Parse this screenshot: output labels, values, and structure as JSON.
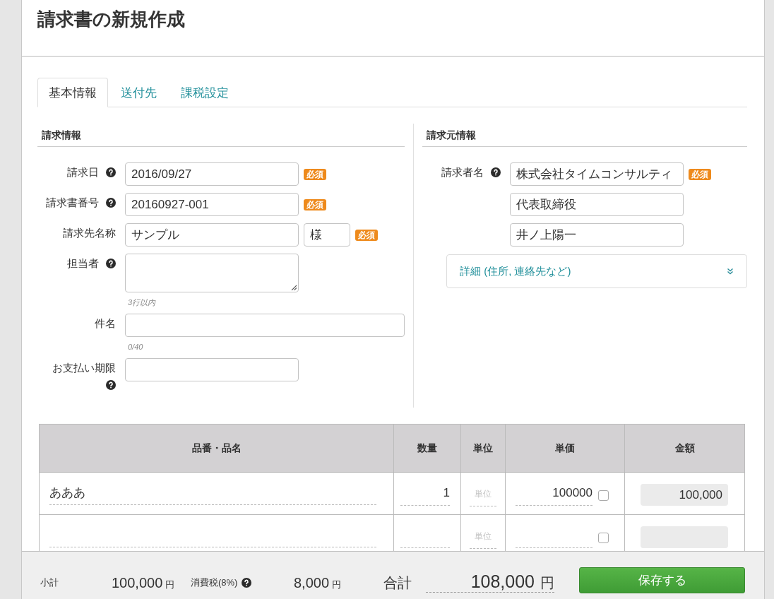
{
  "page": {
    "title": "請求書の新規作成"
  },
  "tabs": [
    {
      "label": "基本情報",
      "selected": true
    },
    {
      "label": "送付先",
      "selected": false
    },
    {
      "label": "課税設定",
      "selected": false
    }
  ],
  "invoice_info": {
    "heading": "請求情報",
    "fields": [
      {
        "kind": "text",
        "label": "請求日",
        "help": true,
        "value": "2016/09/27",
        "badge": "必須"
      },
      {
        "kind": "text",
        "label": "請求書番号",
        "help": true,
        "value": "20160927-001",
        "badge": "必須"
      },
      {
        "kind": "text_with_suffix",
        "label": "請求先名称",
        "help": false,
        "value": "サンプル",
        "suffix": "様",
        "badge": "必須"
      },
      {
        "kind": "textarea",
        "label": "担当者",
        "help": true,
        "hint": "3行以内"
      },
      {
        "kind": "wide_text",
        "label": "件名",
        "help": false,
        "hint": "0/40"
      },
      {
        "kind": "text",
        "label": "お支払い期限",
        "help": true
      }
    ]
  },
  "issuer_info": {
    "heading": "請求元情報",
    "label": "請求者名",
    "help": true,
    "fields": [
      {
        "value": "株式会社タイムコンサルティ",
        "badge": "必須"
      },
      {
        "value": "代表取締役"
      },
      {
        "value": "井ノ上陽一"
      }
    ],
    "details": {
      "label": "詳細 (住所, 連絡先など)",
      "expanded": false
    }
  },
  "items_table": {
    "columns": [
      "品番・品名",
      "数量",
      "単位",
      "単価",
      "金額"
    ],
    "rows": [
      {
        "name": "あああ",
        "quantity": "1",
        "unit_placeholder": "単位",
        "unit_price": "100000",
        "checked": false,
        "amount": "100,000"
      },
      {
        "unit_placeholder": "単位",
        "checked": false
      }
    ]
  },
  "footer": {
    "subtotal_label": "小計",
    "subtotal": "100,000",
    "subtotal_unit": "円",
    "tax_label": "消費税(8%)",
    "tax_help": true,
    "tax": "8,000",
    "tax_unit": "円",
    "total_label": "合計",
    "total": "108,000",
    "total_unit": "円",
    "save_button": "保存する"
  }
}
